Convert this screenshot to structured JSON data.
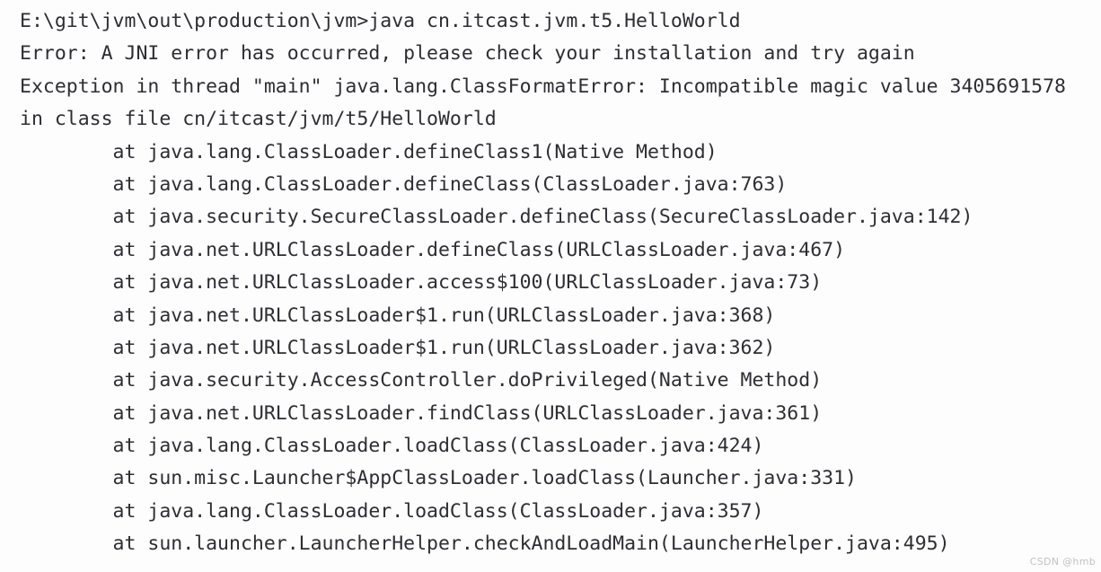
{
  "window": {
    "type": "windows-command-prompt",
    "background_color": "#fdfdfd",
    "text_color": "#2d2d33"
  },
  "console": {
    "prompt_path": "E:\\git\\jvm\\out\\production\\jvm>",
    "command": "java cn.itcast.jvm.t5.HelloWorld",
    "lines": [
      "E:\\git\\jvm\\out\\production\\jvm>java cn.itcast.jvm.t5.HelloWorld",
      "Error: A JNI error has occurred, please check your installation and try again",
      "Exception in thread \"main\" java.lang.ClassFormatError: Incompatible magic value 3405691578",
      "in class file cn/itcast/jvm/t5/HelloWorld",
      "        at java.lang.ClassLoader.defineClass1(Native Method)",
      "        at java.lang.ClassLoader.defineClass(ClassLoader.java:763)",
      "        at java.security.SecureClassLoader.defineClass(SecureClassLoader.java:142)",
      "        at java.net.URLClassLoader.defineClass(URLClassLoader.java:467)",
      "        at java.net.URLClassLoader.access$100(URLClassLoader.java:73)",
      "        at java.net.URLClassLoader$1.run(URLClassLoader.java:368)",
      "        at java.net.URLClassLoader$1.run(URLClassLoader.java:362)",
      "        at java.security.AccessController.doPrivileged(Native Method)",
      "        at java.net.URLClassLoader.findClass(URLClassLoader.java:361)",
      "        at java.lang.ClassLoader.loadClass(ClassLoader.java:424)",
      "        at sun.misc.Launcher$AppClassLoader.loadClass(Launcher.java:331)",
      "        at java.lang.ClassLoader.loadClass(ClassLoader.java:357)",
      "        at sun.launcher.LauncherHelper.checkAndLoadMain(LauncherHelper.java:495)"
    ],
    "error_summary": {
      "error_label": "Error: A JNI error has occurred, please check your installation and try again",
      "exception_type": "java.lang.ClassFormatError",
      "exception_message": "Incompatible magic value 3405691578",
      "thread": "main",
      "class_file": "cn/itcast/jvm/t5/HelloWorld",
      "magic_value": "3405691578"
    }
  },
  "watermark": {
    "text": "CSDN @hmb"
  }
}
